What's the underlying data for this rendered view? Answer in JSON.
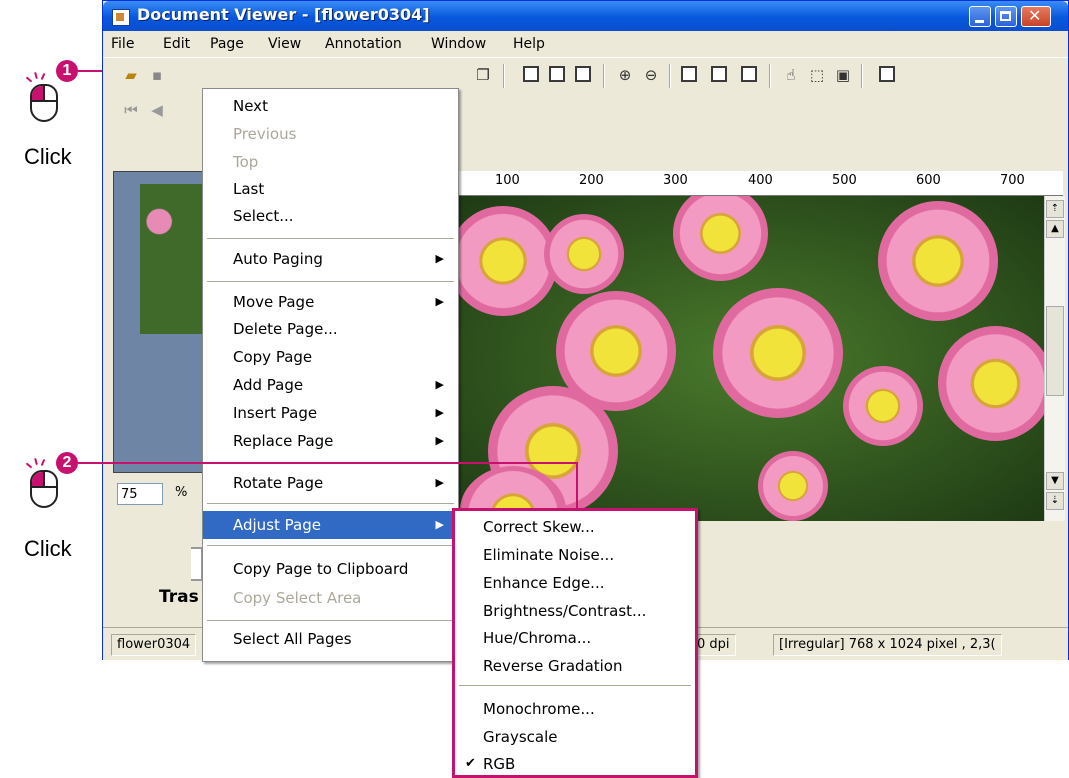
{
  "annotations": {
    "step1": {
      "number": "1",
      "label": "Click"
    },
    "step2": {
      "number": "2",
      "label": "Click"
    }
  },
  "window": {
    "title": "Document Viewer - [flower0304]",
    "controls": [
      "minimize-icon",
      "maximize-icon",
      "close-icon"
    ]
  },
  "menubar": {
    "items": [
      "File",
      "Edit",
      "Page",
      "View",
      "Annotation",
      "Window",
      "Help"
    ]
  },
  "toolbar": {
    "icons": [
      "open-folder-icon",
      "save-icon",
      "copy-icon",
      "rotate-left-icon",
      "rotate-right-icon",
      "rotate-icon",
      "zoom-in-icon",
      "zoom-out-icon",
      "fit-page-icon",
      "fit-width-icon",
      "fit-window-icon",
      "hand-icon",
      "select-area-icon",
      "annotation-icon",
      "thumbnail-panel-icon"
    ]
  },
  "ruler": {
    "labels": [
      "100",
      "200",
      "300",
      "400",
      "500",
      "600",
      "700"
    ]
  },
  "zoom": {
    "value": "75",
    "unit": "%"
  },
  "trash_label": "Tras",
  "status": {
    "file": "flower0304",
    "dpi": "0 dpi",
    "info": "[Irregular]  768 x 1024 pixel , 2,3("
  },
  "page_menu": {
    "items": [
      {
        "label": "Next",
        "disabled": false,
        "submenu": false
      },
      {
        "label": "Previous",
        "disabled": true,
        "submenu": false
      },
      {
        "label": "Top",
        "disabled": true,
        "submenu": false
      },
      {
        "label": "Last",
        "disabled": false,
        "submenu": false
      },
      {
        "label": "Select...",
        "disabled": false,
        "submenu": false
      },
      {
        "label": "Auto Paging",
        "disabled": false,
        "submenu": true
      },
      {
        "label": "Move Page",
        "disabled": false,
        "submenu": true
      },
      {
        "label": "Delete Page...",
        "disabled": false,
        "submenu": false
      },
      {
        "label": "Copy Page",
        "disabled": false,
        "submenu": false
      },
      {
        "label": "Add Page",
        "disabled": false,
        "submenu": true
      },
      {
        "label": "Insert Page",
        "disabled": false,
        "submenu": true
      },
      {
        "label": "Replace Page",
        "disabled": false,
        "submenu": true
      },
      {
        "label": "Rotate Page",
        "disabled": false,
        "submenu": true
      },
      {
        "label": "Adjust Page",
        "disabled": false,
        "submenu": true,
        "highlighted": true
      },
      {
        "label": "Copy Page to Clipboard",
        "disabled": false,
        "submenu": false
      },
      {
        "label": "Copy Select Area",
        "disabled": true,
        "submenu": false
      },
      {
        "label": "Select All Pages",
        "disabled": false,
        "submenu": false
      }
    ]
  },
  "adjust_submenu": {
    "items": [
      {
        "label": "Correct Skew..."
      },
      {
        "label": "Eliminate Noise..."
      },
      {
        "label": "Enhance Edge..."
      },
      {
        "label": "Brightness/Contrast..."
      },
      {
        "label": "Hue/Chroma..."
      },
      {
        "label": "Reverse Gradation"
      },
      {
        "label": "Monochrome..."
      },
      {
        "label": "Grayscale"
      },
      {
        "label": "RGB",
        "checked": true
      }
    ]
  },
  "colors": {
    "accent": "#c8106e",
    "highlight": "#316ac5",
    "title": "#0a56d8",
    "menu_bg": "#ece9d8"
  }
}
